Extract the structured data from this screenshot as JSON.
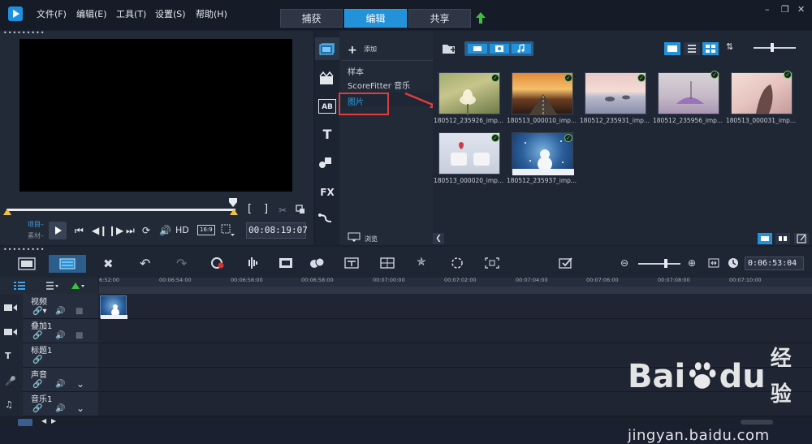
{
  "menu": [
    "文件(F)",
    "编辑(E)",
    "工具(T)",
    "设置(S)",
    "帮助(H)"
  ],
  "tabs": [
    "捕获",
    "编辑",
    "共享"
  ],
  "player": {
    "mode_project": "项目",
    "mode_clip": "素材",
    "hd_label": "HD",
    "aspect_label": "16:9",
    "timecode": "00:08:19:07",
    "mark_in": "[",
    "mark_out": "]"
  },
  "library": {
    "add_label": "添加",
    "folders": [
      "样本",
      "ScoreFitter 音乐",
      "图片"
    ],
    "browse_label": "浏览",
    "thumbnails": [
      "180512_235926_imp...",
      "180513_000010_imp...",
      "180512_235931_imp...",
      "180512_235956_imp...",
      "180513_000031_imp...",
      "180513_000020_imp...",
      "180512_235937_imp..."
    ]
  },
  "timeline": {
    "timecode": "0:06:53:04",
    "ruler": [
      "6:52:00",
      "00:06:54:00",
      "00:06:56:00",
      "00:06:58:00",
      "00:07:00:00",
      "00:07:02:00",
      "00:07:04:00",
      "00:07:06:00",
      "00:07:08:00",
      "00:07:10:00"
    ],
    "tracks": [
      "视频",
      "叠加1",
      "标题1",
      "声音",
      "音乐1"
    ]
  },
  "watermark": {
    "brand": "Bai",
    "brand2": "du",
    "chinese": "经验",
    "url": "jingyan.baidu.com"
  },
  "colors": {
    "accent": "#2492d8",
    "highlight_border": "#e23b3b",
    "check": "#6ad04c",
    "arrow": "#e23b3b"
  }
}
